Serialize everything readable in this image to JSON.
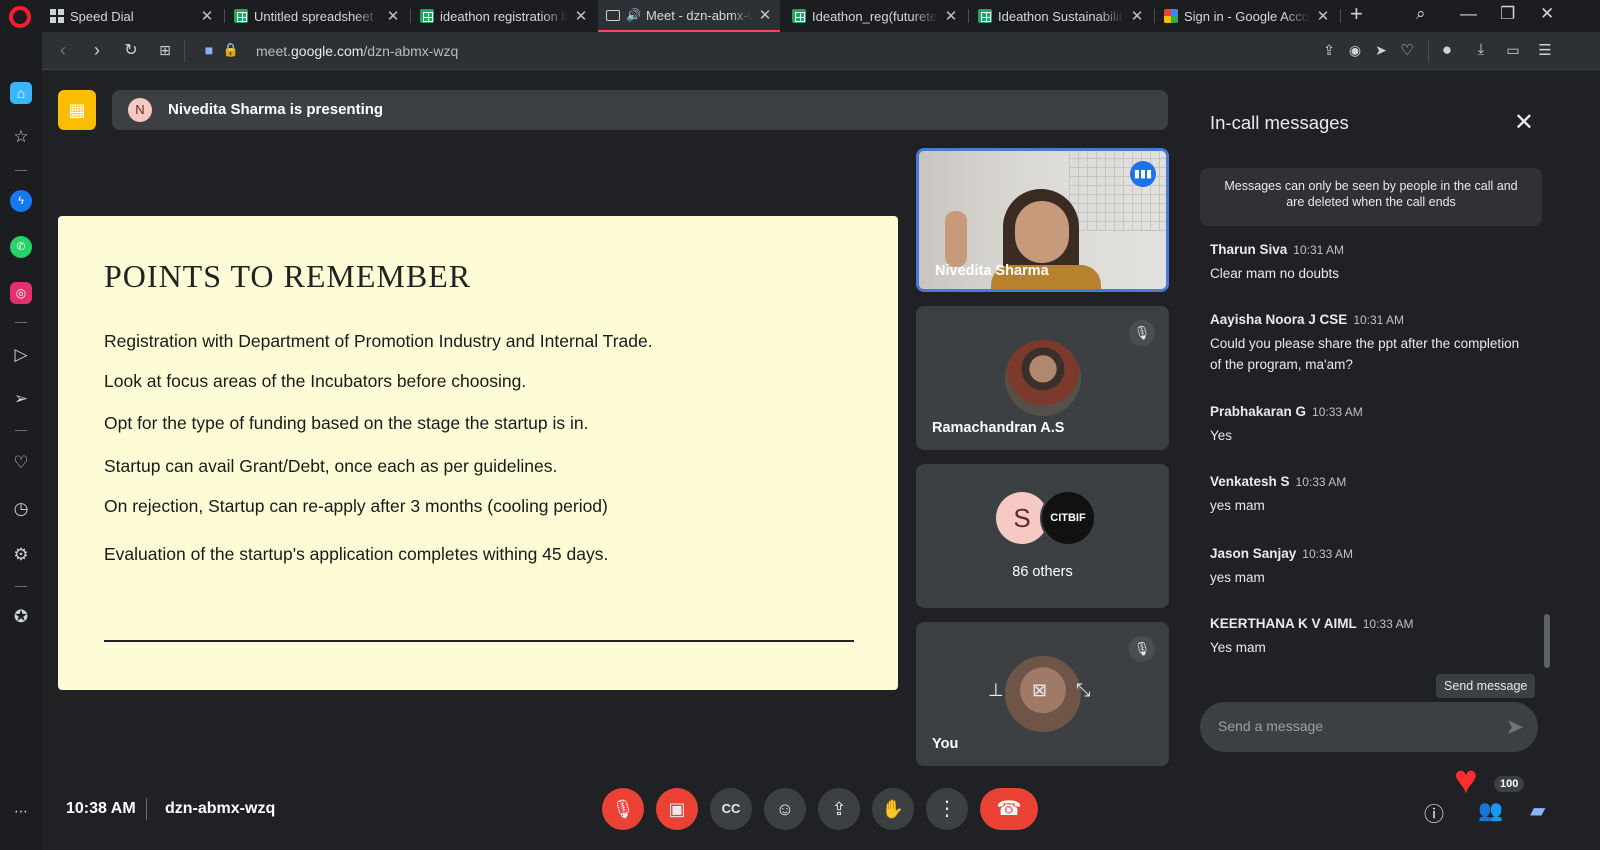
{
  "browser": {
    "tabs": [
      {
        "title": "Speed Dial",
        "icon": "grid"
      },
      {
        "title": "Untitled spreadsheet - G",
        "icon": "sheet"
      },
      {
        "title": "ideathon registration list",
        "icon": "sheet"
      },
      {
        "title": "Meet - dzn-abmx-wzq",
        "icon": "meet",
        "active": true
      },
      {
        "title": "Ideathon_reg(futuretech",
        "icon": "sheet"
      },
      {
        "title": "Ideathon Sustainability(r",
        "icon": "sheet"
      },
      {
        "title": "Sign in - Google Accoun",
        "icon": "google"
      }
    ],
    "url_prefix": "meet.",
    "url_host": "google.com",
    "url_path": "/dzn-abmx-wzq"
  },
  "presentation": {
    "banner_initial": "N",
    "banner_text": "Nivedita Sharma is presenting",
    "slide": {
      "title": "POINTS TO REMEMBER",
      "points": [
        "Registration with Department of Promotion Industry and Internal Trade.",
        "Look at focus areas of the Incubators before choosing.",
        "Opt for the type of funding based on the stage the startup is in.",
        "Startup can avail Grant/Debt, once each as per guidelines.",
        "On rejection, Startup can re-apply after 3 months (cooling period)",
        "Evaluation of the startup's application completes withing 45 days."
      ]
    }
  },
  "participants": {
    "presenter_name": "Nivedita Sharma",
    "tile2_name": "Ramachandran A.S",
    "tile3_initial": "S",
    "tile3_logo_text": "CITBIF",
    "tile3_others": "86 others",
    "self_name": "You"
  },
  "chat": {
    "title": "In-call messages",
    "note": "Messages can only be seen by people in the call and are deleted when the call ends",
    "messages": [
      {
        "sender": "Tharun Siva",
        "time": "10:31 AM",
        "text": "Clear mam no doubts"
      },
      {
        "sender": "Aayisha Noora J CSE",
        "time": "10:31 AM",
        "text": "Could you please share the ppt after the completion of the program, ma'am?"
      },
      {
        "sender": "Prabhakaran G",
        "time": "10:33 AM",
        "text": "Yes"
      },
      {
        "sender": "Venkatesh S",
        "time": "10:33 AM",
        "text": "yes mam"
      },
      {
        "sender": "Jason Sanjay",
        "time": "10:33 AM",
        "text": "yes mam"
      },
      {
        "sender": "KEERTHANA K V AIML",
        "time": "10:33 AM",
        "text": "Yes mam"
      }
    ],
    "input_placeholder": "Send a message",
    "tooltip": "Send message"
  },
  "bottom": {
    "time": "10:38 AM",
    "meeting_code": "dzn-abmx-wzq",
    "people_count": "100"
  },
  "colors": {
    "accent_red": "#ea4335",
    "present_yellow": "#fbbc04",
    "slide_bg": "#fefbd7",
    "active_speaker_blue": "#4a79d8"
  }
}
